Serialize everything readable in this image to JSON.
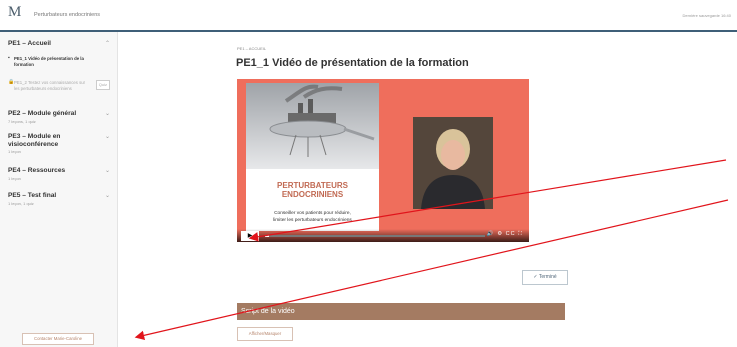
{
  "header": {
    "logo_text": "M",
    "course_title": "Perturbateurs endocriniens",
    "saved_status": "Dernière sauvegarde 16:40"
  },
  "sidebar": {
    "modules": [
      {
        "title": "PE1 – Accueil",
        "subtitle": "",
        "lessons": [
          {
            "title": "PE1_1 Vidéo de présentation de la formation",
            "state": "active"
          },
          {
            "title": "PE1_2 Testez vos connaissances sur les perturbateurs endocriniens",
            "state": "locked",
            "badge": "Quiz"
          }
        ]
      },
      {
        "title": "PE2 – Module général",
        "subtitle": "7 leçons, 1 quiz"
      },
      {
        "title": "PE3 – Module en visioconférence",
        "subtitle": "1 leçon"
      },
      {
        "title": "PE4 – Ressources",
        "subtitle": "1 leçon"
      },
      {
        "title": "PE5 – Test final",
        "subtitle": "1 leçon, 1 quiz"
      }
    ],
    "contact_label": "Contacter Marie-Caroline"
  },
  "main": {
    "breadcrumb": "PE1 – ACCUEIL",
    "title": "PE1_1 Vidéo de présentation de la formation",
    "video": {
      "heading_line1": "PERTURBATEURS",
      "heading_line2": "ENDOCRINIENS",
      "text_line1": "Conseiller vos patients pour réduire,",
      "text_line2": "limiter les perturbateurs endocriniens",
      "progress": 0.02,
      "controls": "🔊 ⚙ CC ⛶"
    },
    "done_label": "✓ Terminé",
    "script_title": "Script de la vidéo",
    "toggle_label": "Afficher/Masquer"
  },
  "colors": {
    "video_bg": "#ef6e5c",
    "script_bar": "#a47b62",
    "header_rule": "#3f5f78"
  }
}
